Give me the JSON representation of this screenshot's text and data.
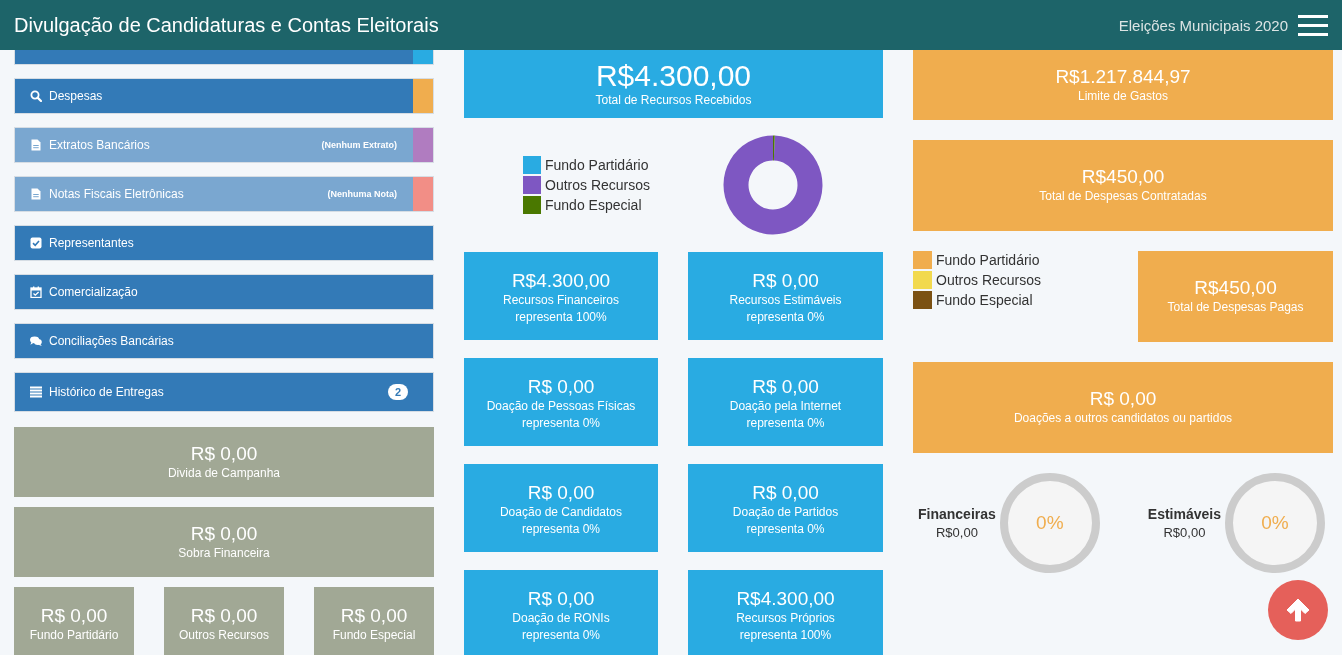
{
  "header": {
    "title": "Divulgação de Candidaturas e Contas Eleitorais",
    "subtitle": "Eleições Municipais 2020"
  },
  "menu": [
    {
      "kind": "cut",
      "color": "#29abe2",
      "disabled": false
    },
    {
      "kind": "item",
      "label": "Despesas",
      "color": "#f0ad4e",
      "disabled": false
    },
    {
      "kind": "item",
      "label": "Extratos Bancários",
      "note": "(Nenhum Extrato)",
      "color": "#b07cc0",
      "disabled": true
    },
    {
      "kind": "item",
      "label": "Notas Fiscais Eletrônicas",
      "note": "(Nenhuma Nota)",
      "color": "#f28e86",
      "disabled": true
    },
    {
      "kind": "item",
      "label": "Representantes",
      "disabled": false
    },
    {
      "kind": "item",
      "label": "Comercialização",
      "disabled": false
    },
    {
      "kind": "item",
      "label": "Conciliações Bancárias",
      "disabled": false
    },
    {
      "kind": "item",
      "label": "Histórico de Entregas",
      "badge": "2",
      "disabled": false
    }
  ],
  "summary_cards": [
    {
      "value": "R$ 0,00",
      "label": "Divida de Campanha"
    },
    {
      "value": "R$ 0,00",
      "label": "Sobra Financeira"
    }
  ],
  "fund_cards": [
    {
      "value": "R$ 0,00",
      "label": "Fundo Partidário"
    },
    {
      "value": "R$ 0,00",
      "label": "Outros Recursos"
    },
    {
      "value": "R$ 0,00",
      "label": "Fundo Especial"
    }
  ],
  "revenue": {
    "total": {
      "value": "R$4.300,00",
      "label": "Total de Recursos Recebidos"
    },
    "legend": [
      {
        "label": "Fundo Partidário",
        "color": "#29abe2"
      },
      {
        "label": "Outros Recursos",
        "color": "#7e57c2"
      },
      {
        "label": "Fundo Especial",
        "color": "#4a7800"
      }
    ],
    "cards": [
      {
        "value": "R$4.300,00",
        "label": "Recursos Financeiros",
        "share": "representa 100%"
      },
      {
        "value": "R$ 0,00",
        "label": "Recursos Estimáveis",
        "share": "representa 0%"
      },
      {
        "value": "R$ 0,00",
        "label": "Doação de Pessoas Físicas",
        "share": "representa 0%"
      },
      {
        "value": "R$ 0,00",
        "label": "Doação pela Internet",
        "share": "representa 0%"
      },
      {
        "value": "R$ 0,00",
        "label": "Doação de Candidatos",
        "share": "representa 0%"
      },
      {
        "value": "R$ 0,00",
        "label": "Doação de Partidos",
        "share": "representa 0%"
      },
      {
        "value": "R$ 0,00",
        "label": "Doação de RONIs",
        "share": "representa 0%"
      },
      {
        "value": "R$4.300,00",
        "label": "Recursos Próprios",
        "share": "representa 100%"
      }
    ]
  },
  "expenses": {
    "limit": {
      "value": "R$1.217.844,97",
      "label": "Limite de Gastos"
    },
    "contracted": {
      "value": "R$450,00",
      "label": "Total de Despesas Contratadas"
    },
    "legend": [
      {
        "label": "Fundo Partidário",
        "color": "#f0ad4e"
      },
      {
        "label": "Outros Recursos",
        "color": "#f2d94e"
      },
      {
        "label": "Fundo Especial",
        "color": "#7b5113"
      }
    ],
    "paid": {
      "value": "R$450,00",
      "label": "Total de Despesas Pagas"
    },
    "donations": {
      "value": "R$ 0,00",
      "label": "Doações a outros candidatos ou partidos"
    },
    "gauges": [
      {
        "label": "Financeiras",
        "amount": "R$0,00",
        "percent": "0%"
      },
      {
        "label": "Estimáveis",
        "amount": "R$0,00",
        "percent": "0%"
      }
    ]
  }
}
